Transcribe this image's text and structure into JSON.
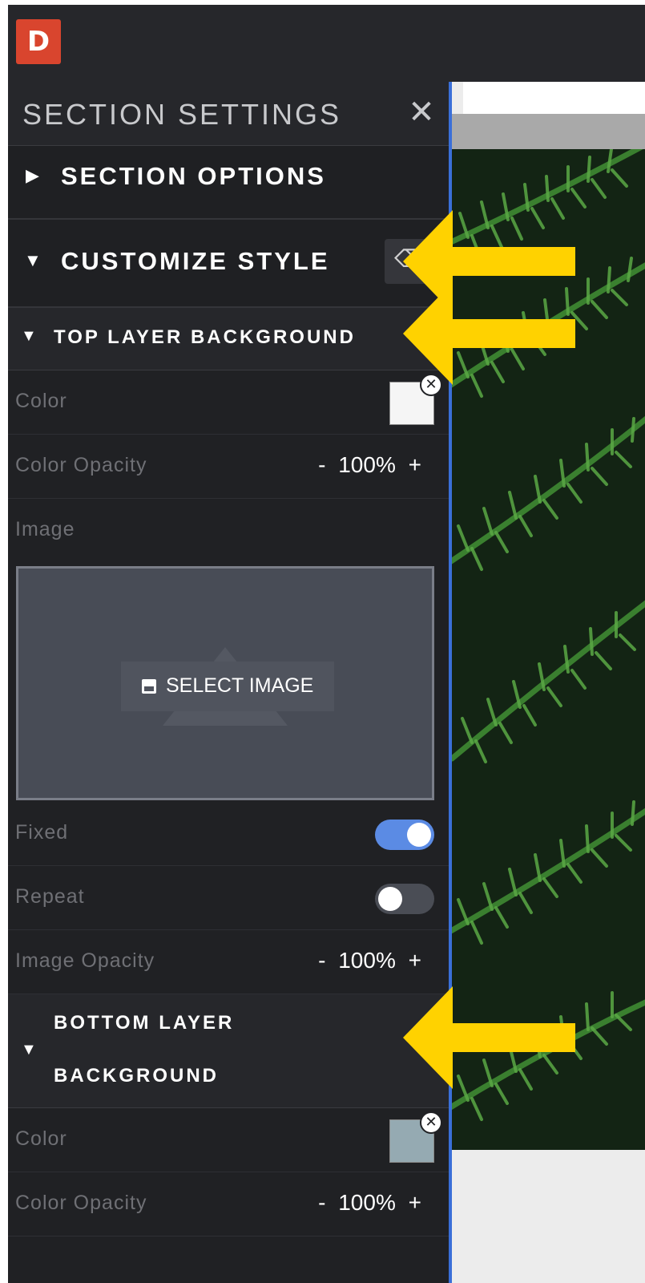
{
  "app": {
    "logo": "D"
  },
  "panel": {
    "title": "SECTION SETTINGS",
    "close_glyph": "✕",
    "section_options": {
      "label": "SECTION OPTIONS",
      "caret": "▶"
    },
    "customize_style": {
      "label": "CUSTOMIZE STYLE",
      "caret": "▼"
    },
    "top_layer": {
      "label": "TOP LAYER BACKGROUND",
      "caret": "▼",
      "color_label": "Color",
      "color_value": "#f5f5f5",
      "color_opacity_label": "Color Opacity",
      "color_opacity_value": "100%",
      "image_label": "Image",
      "select_image": "SELECT IMAGE",
      "fixed_label": "Fixed",
      "fixed": true,
      "repeat_label": "Repeat",
      "repeat": false,
      "image_opacity_label": "Image Opacity",
      "image_opacity_value": "100%"
    },
    "bottom_layer": {
      "label_line1": "BOTTOM LAYER",
      "label_line2": "BACKGROUND",
      "caret": "▼",
      "color_label": "Color",
      "color_value": "#95aab2",
      "color_opacity_label": "Color Opacity",
      "color_opacity_value": "100%"
    },
    "stepper": {
      "minus": "-",
      "plus": "+"
    },
    "remove_glyph": "✕"
  },
  "colors": {
    "accent_blue": "#5b8be4",
    "logo_red": "#d9452e",
    "annotation_yellow": "#ffd200"
  }
}
